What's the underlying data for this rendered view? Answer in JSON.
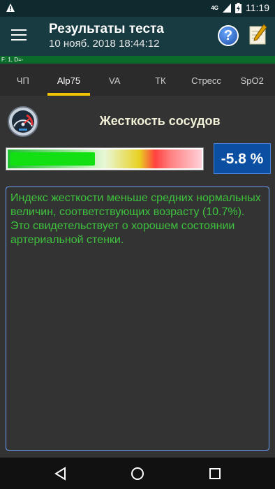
{
  "status_bar": {
    "warning_icon": "warning-triangle-icon",
    "network": "4G",
    "time": "11:19"
  },
  "app_bar": {
    "title": "Результаты теста",
    "date": "10 нояб. 2018  18:44:12",
    "help_label": "?"
  },
  "info_strip": "F: 1, D=-",
  "tabs": [
    {
      "label": "ЧП"
    },
    {
      "label": "Alp75"
    },
    {
      "label": "VA"
    },
    {
      "label": "ТК"
    },
    {
      "label": "Стресс"
    },
    {
      "label": "SpO2"
    }
  ],
  "active_tab": 1,
  "section": {
    "title": "Жесткость сосудов",
    "value": "-5.8 %",
    "bar_fill_fraction": 0.45,
    "description": "Индекс жесткости меньше средних нормальных величин, соответствующих возрасту (10.7%). Это свидетельствует о хорошем состоянии артериальной стенки."
  },
  "colors": {
    "app_bar": "#173b40",
    "accent_tab": "#f2c500",
    "value_box": "#0b4fa3",
    "description_text": "#3ec23e"
  }
}
